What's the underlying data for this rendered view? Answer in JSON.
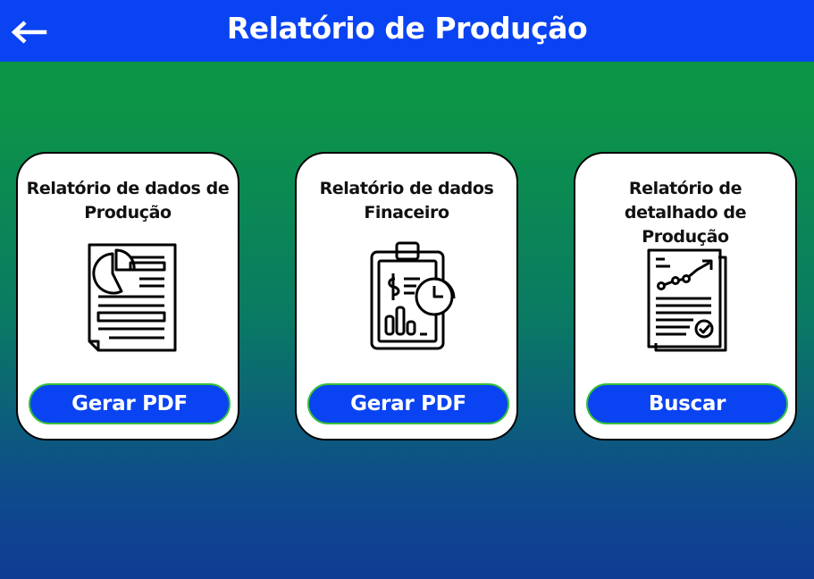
{
  "header": {
    "title": "Relatório de Produção",
    "back_icon": "arrow-left-icon"
  },
  "colors": {
    "header_bg": "#0a43f2",
    "button_bg": "#0a43f2",
    "button_border": "#34c03a",
    "bg_top": "#0c9447",
    "bg_bottom": "#103c94"
  },
  "cards": [
    {
      "title": "Relatório de dados de Produção",
      "button_label": "Gerar PDF",
      "icon": "document-pie-chart-icon"
    },
    {
      "title": "Relatório de dados Finaceiro",
      "button_label": "Gerar PDF",
      "icon": "clipboard-finance-chart-icon"
    },
    {
      "title": "Relatório de detalhado de Produção",
      "button_label": "Buscar",
      "icon": "report-trend-line-icon"
    }
  ]
}
